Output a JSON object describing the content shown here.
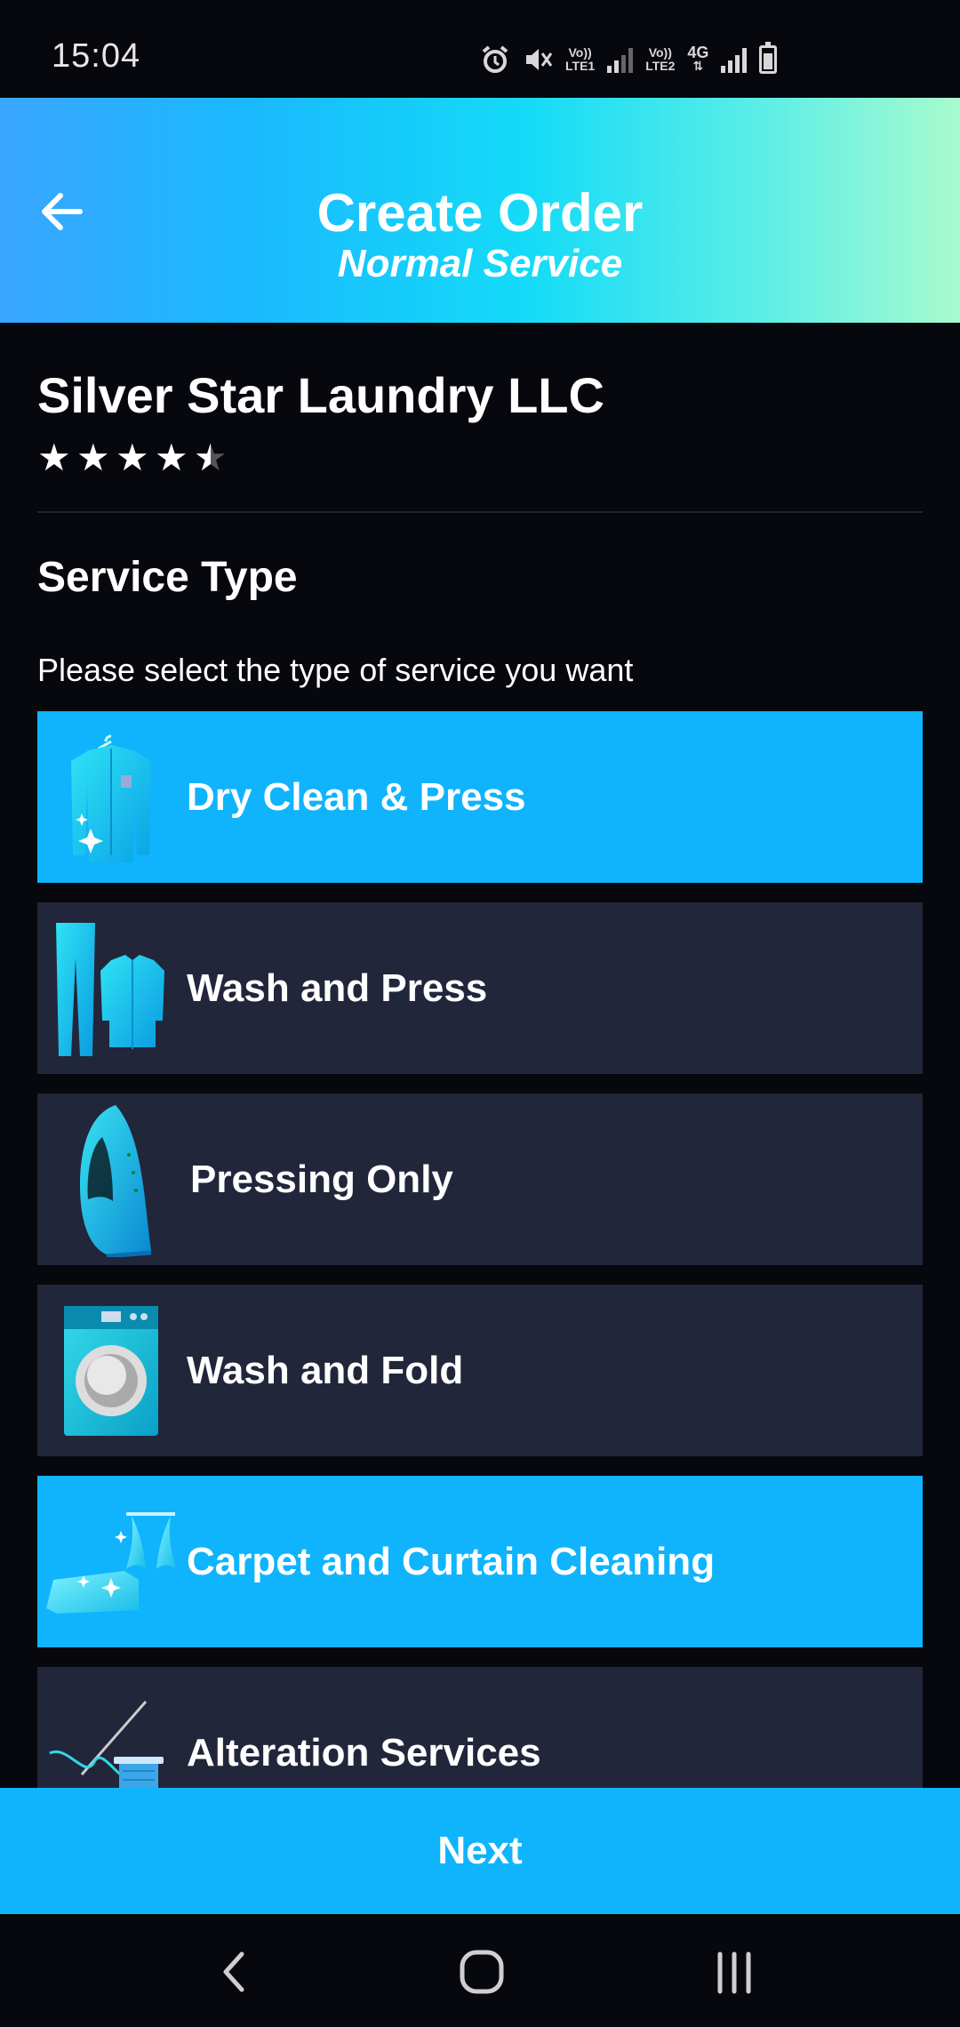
{
  "status_bar": {
    "time": "15:04",
    "sim1_top": "Vo))",
    "sim1_bottom": "LTE1",
    "sim2_top": "Vo))",
    "sim2_bottom": "LTE2",
    "network": "4G"
  },
  "header": {
    "title": "Create Order",
    "subtitle": "Normal Service"
  },
  "shop": {
    "name": "Silver Star Laundry LLC",
    "rating": 4.5,
    "rating_max": 5
  },
  "section": {
    "title": "Service Type",
    "subtitle": "Please select the type of service you want"
  },
  "services": [
    {
      "label": "Dry Clean & Press",
      "icon": "shirt-icon",
      "selected": true
    },
    {
      "label": "Wash and Press",
      "icon": "pants-shirt-icon",
      "selected": false
    },
    {
      "label": "Pressing Only",
      "icon": "iron-icon",
      "selected": false
    },
    {
      "label": "Wash and Fold",
      "icon": "washing-machine-icon",
      "selected": false
    },
    {
      "label": "Carpet and Curtain Cleaning",
      "icon": "carpet-curtain-icon",
      "selected": true
    },
    {
      "label": "Alteration Services",
      "icon": "needle-thread-icon",
      "selected": false
    }
  ],
  "next_button": {
    "label": "Next"
  },
  "colors": {
    "accent": "#0fb4fd",
    "card": "#22263a",
    "background": "#07080d"
  }
}
